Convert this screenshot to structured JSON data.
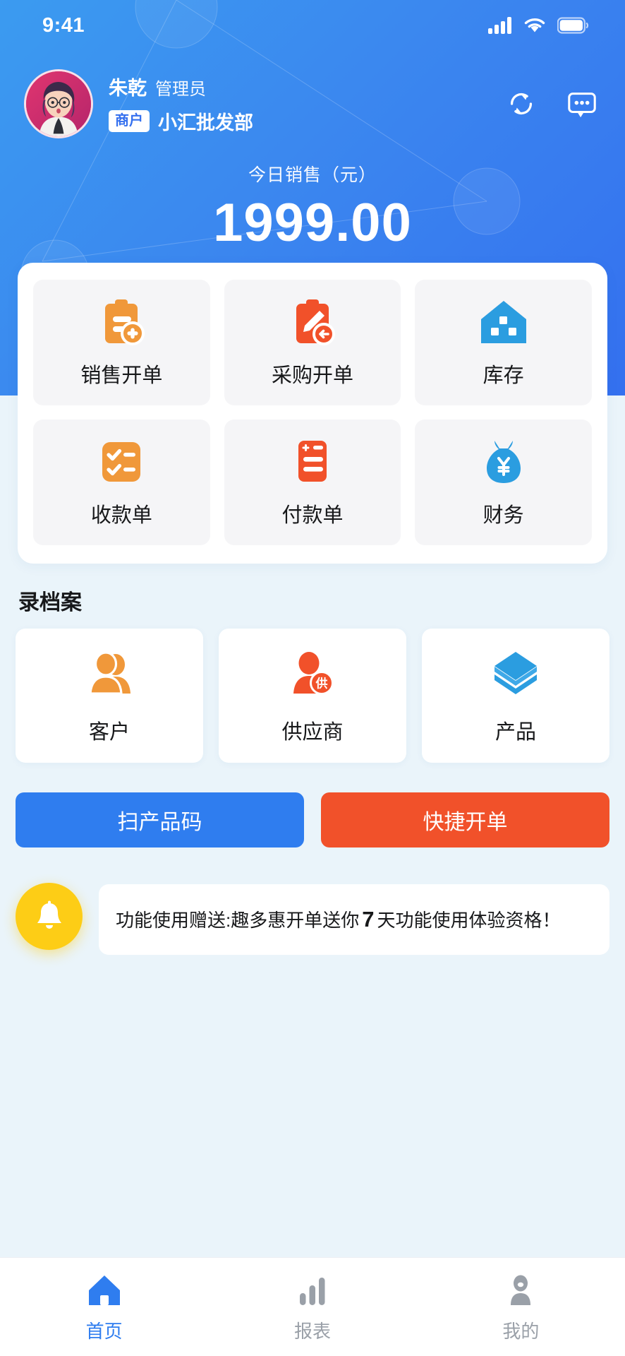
{
  "status_bar": {
    "time": "9:41",
    "signal_icon": "cellular-signal-icon",
    "wifi_icon": "wifi-icon",
    "battery_icon": "battery-icon"
  },
  "header": {
    "avatar_icon": "user-avatar",
    "user_name": "朱乾",
    "user_role": "管理员",
    "merchant_tag": "商户",
    "merchant_name": "小汇批发部",
    "refresh_icon": "refresh-icon",
    "message_icon": "message-icon",
    "sales_label": "今日销售（元）",
    "sales_value": "1999.00"
  },
  "quick_grid": [
    {
      "label": "销售开单",
      "icon": "clipboard-plus-icon",
      "color": "#f0983a"
    },
    {
      "label": "采购开单",
      "icon": "clipboard-pencil-icon",
      "color": "#f1512a"
    },
    {
      "label": "库存",
      "icon": "warehouse-icon",
      "color": "#2b9de0"
    },
    {
      "label": "收款单",
      "icon": "checklist-icon",
      "color": "#f0983a"
    },
    {
      "label": "付款单",
      "icon": "invoice-yuan-icon",
      "color": "#f1512a"
    },
    {
      "label": "财务",
      "icon": "money-bag-yuan-icon",
      "color": "#2b9de0"
    }
  ],
  "archive": {
    "title": "录档案",
    "items": [
      {
        "label": "客户",
        "icon": "customers-icon",
        "color": "#f0983a"
      },
      {
        "label": "供应商",
        "icon": "supplier-icon",
        "color": "#f1512a",
        "badge": "供"
      },
      {
        "label": "产品",
        "icon": "product-layers-icon",
        "color": "#2b9de0"
      }
    ]
  },
  "actions": {
    "scan_label": "扫产品码",
    "scan_color": "#2f7def",
    "quick_label": "快捷开单",
    "quick_color": "#f1512a"
  },
  "notice": {
    "bell_icon": "bell-icon",
    "bell_color": "#fdcd16",
    "text_before": "功能使用赠送:趣多惠开单送你",
    "highlight": "7",
    "text_after": "天功能使用体验资格！"
  },
  "tabbar": [
    {
      "label": "首页",
      "icon": "home-icon",
      "active": true
    },
    {
      "label": "报表",
      "icon": "bar-chart-icon",
      "active": false
    },
    {
      "label": "我的",
      "icon": "person-icon",
      "active": false
    }
  ]
}
